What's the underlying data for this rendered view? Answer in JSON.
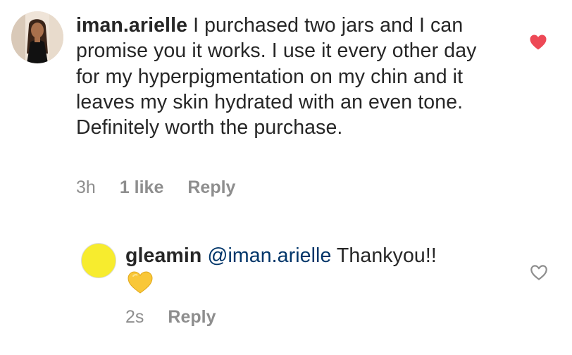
{
  "comment": {
    "username": "iman.arielle",
    "text": " I purchased two jars and I can promise you it works. I use it every other day for my hyperpigmentation on my chin and it leaves my skin hydrated with an even tone. Definitely worth the purchase.",
    "time": "3h",
    "likes": "1 like",
    "reply_label": "Reply",
    "liked": true,
    "like_color": "#ed4956"
  },
  "reply": {
    "username": "gleamin",
    "mention": "@iman.arielle",
    "text": " Thankyou!!",
    "emoji": "yellow-heart",
    "time": "2s",
    "reply_label": "Reply",
    "liked": false,
    "avatar_color": "#f7ec2e",
    "mention_color": "#003569"
  }
}
